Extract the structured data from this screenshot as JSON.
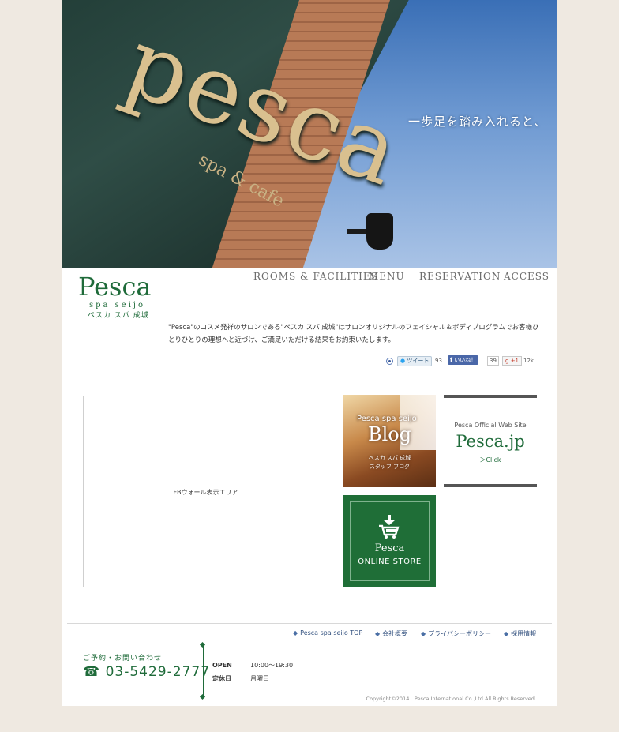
{
  "hero": {
    "sign_text": "pesca",
    "sign_sub": "spa & cafe",
    "tagline": "一歩足を踏み入れると、"
  },
  "logo": {
    "name": "Pesca",
    "sub_en": "spa seijo",
    "sub_ja": "ペスカ スパ 成城"
  },
  "nav": [
    "ROOMS & FACILITIES",
    "MENU",
    "RESERVATION",
    "ACCESS"
  ],
  "intro": "\"Pesca\"のコスメ発祥のサロンである\"ペスカ スパ 成城\"はサロンオリジナルのフェイシャル＆ボディプログラムでお客様ひとりひとりの理想へと近づけ、ご満足いただける結果をお約束いたします。",
  "social": {
    "tweet": "ツイート",
    "tweet_count": "93",
    "like": "いいね！",
    "like_count": "39",
    "gplus": "+1",
    "gplus_count": "12k"
  },
  "fbwall": {
    "label": "FBウォール表示エリア"
  },
  "blog": {
    "line1": "Pesca spa seijo",
    "title": "Blog",
    "line3": "ペスカ スパ 成城",
    "line4": "スタッフ ブログ"
  },
  "official": {
    "caption": "Pesca Official Web Site",
    "title": "Pesca.jp",
    "link": "＞Click"
  },
  "store": {
    "line1": "Pesca",
    "line2": "ONLINE STORE",
    "icon": "cart-download-icon"
  },
  "footer": {
    "links": [
      "Pesca spa seijo TOP",
      "会社概要",
      "プライバシーポリシー",
      "採用情報"
    ],
    "contact_label": "ご予約・お問い合わせ",
    "phone": "03-5429-2777",
    "phone_icon": "telephone-icon",
    "hours": [
      {
        "label": "OPEN",
        "value": "10:00～19:30"
      },
      {
        "label": "定休日",
        "value": "月曜日"
      }
    ],
    "copyright": "Copyright©2014　Pesca International Co.,Ltd All Rights Reserved."
  },
  "colors": {
    "background": "#efe9e1",
    "brand_green": "#1f6b3a",
    "store_green": "#1f6e37",
    "link_blue": "#2e4d7c"
  }
}
